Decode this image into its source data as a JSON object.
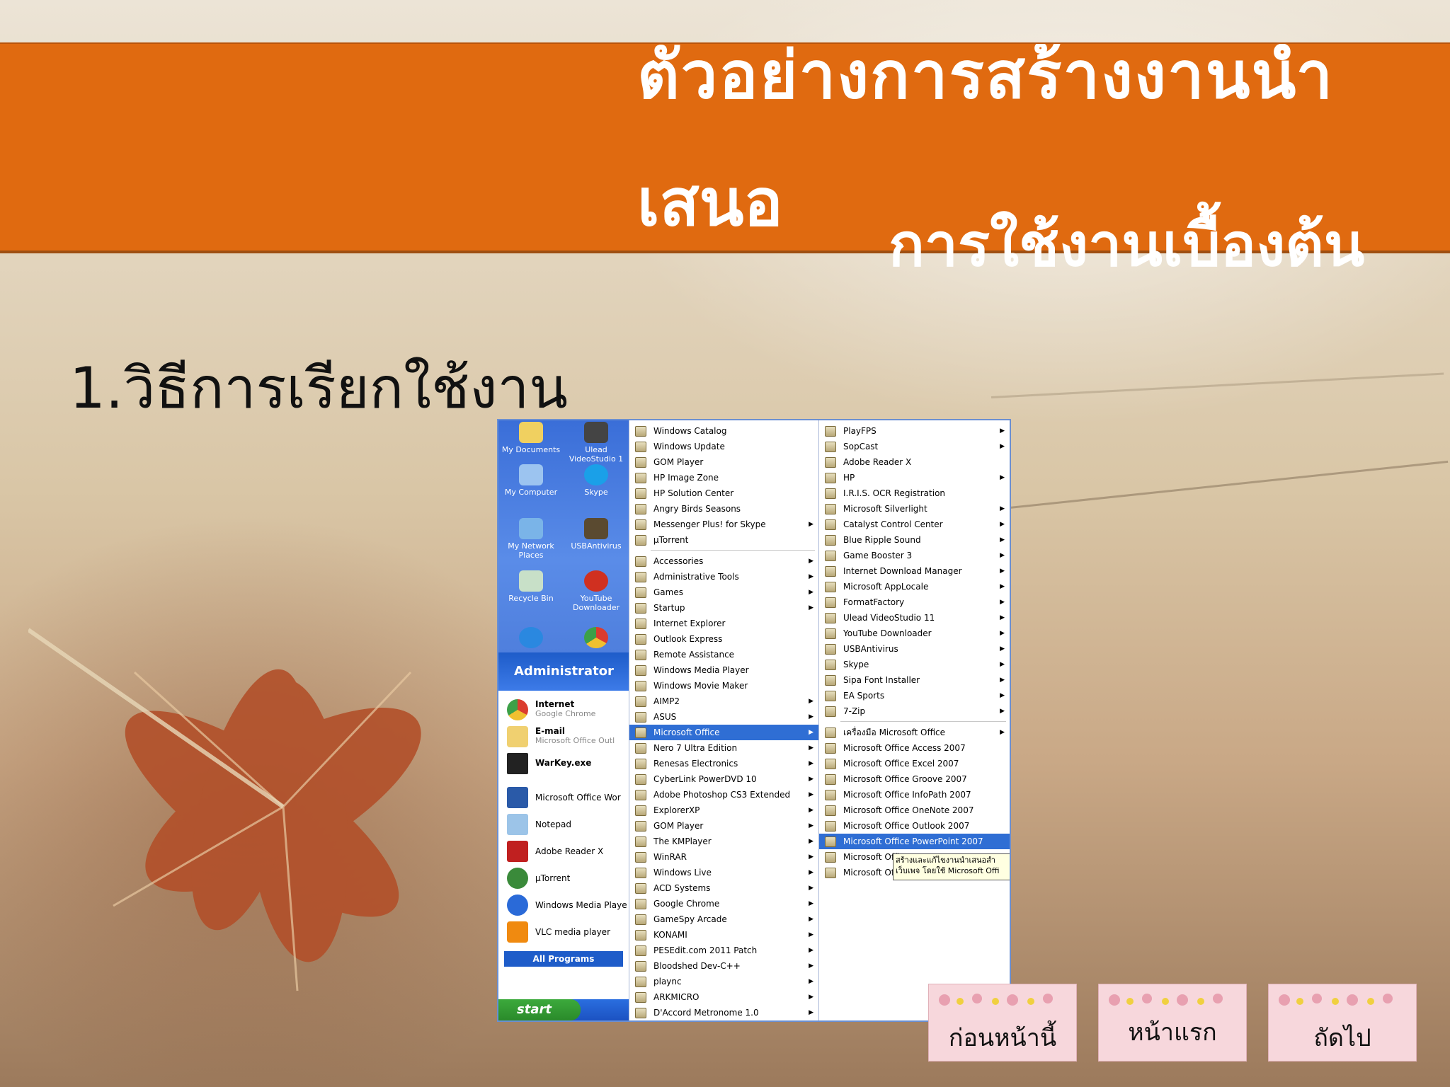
{
  "title": {
    "line1": "ตัวอย่างการสร้างงานนำ",
    "line2": "เสนอ",
    "subtitle": "การใช้งานเบื้องต้น"
  },
  "step_heading": "1.วิธีการเรียกใช้งาน",
  "screenshot": {
    "desktop_icons": [
      "My Documents",
      "Ulead VideoStudio 1",
      "My Computer",
      "Skype",
      "My Network Places",
      "USBAntivirus",
      "Recycle Bin",
      "YouTube Downloader"
    ],
    "user": "Administrator",
    "pinned": [
      {
        "title": "Internet",
        "sub": "Google Chrome"
      },
      {
        "title": "E-mail",
        "sub": "Microsoft Office Outl"
      },
      {
        "title": "WarKey.exe",
        "sub": ""
      }
    ],
    "recent": [
      "Microsoft Office Wor",
      "Notepad",
      "Adobe Reader X",
      "µTorrent",
      "Windows Media Playe",
      "VLC media player"
    ],
    "all_programs": "All Programs",
    "start": "start",
    "programs_top": [
      "Windows Catalog",
      "Windows Update",
      "GOM Player",
      "HP Image Zone",
      "HP Solution Center",
      "Angry Birds Seasons",
      "Messenger Plus! for Skype",
      "µTorrent"
    ],
    "programs": [
      "Accessories",
      "Administrative Tools",
      "Games",
      "Startup",
      "Internet Explorer",
      "Outlook Express",
      "Remote Assistance",
      "Windows Media Player",
      "Windows Movie Maker",
      "AIMP2",
      "ASUS",
      "Microsoft Office",
      "Nero 7 Ultra Edition",
      "Renesas Electronics",
      "CyberLink PowerDVD 10",
      "Adobe Photoshop CS3 Extended",
      "ExplorerXP",
      "GOM Player",
      "The KMPlayer",
      "WinRAR",
      "Windows Live",
      "ACD Systems",
      "Google Chrome",
      "GameSpy Arcade",
      "KONAMI",
      "PESEdit.com 2011 Patch",
      "Bloodshed Dev-C++",
      "plaync",
      "ARKMICRO",
      "D'Accord Metronome 1.0"
    ],
    "programs2": [
      "PlayFPS",
      "SopCast",
      "Adobe Reader X",
      "HP",
      "I.R.I.S. OCR Registration",
      "Microsoft Silverlight",
      "Catalyst Control Center",
      "Blue Ripple Sound",
      "Game Booster 3",
      "Internet Download Manager",
      "Microsoft AppLocale",
      "FormatFactory",
      "Ulead VideoStudio 11",
      "YouTube Downloader",
      "USBAntivirus",
      "Skype",
      "Sipa Font Installer",
      "EA Sports",
      "7-Zip"
    ],
    "office_menu": [
      "เครื่องมือ Microsoft Office",
      "Microsoft Office Access 2007",
      "Microsoft Office Excel 2007",
      "Microsoft Office Groove 2007",
      "Microsoft Office InfoPath 2007",
      "Microsoft Office OneNote 2007",
      "Microsoft Office Outlook 2007",
      "Microsoft Office PowerPoint 2007",
      "Microsoft Office",
      "Microsoft Office"
    ],
    "tooltip_line1": "สร้างและแก้ไขงานนำเสนอสำ",
    "tooltip_line2": "เว็บเพจ โดยใช้ Microsoft Offi"
  },
  "nav": {
    "prev": "ก่อนหน้านี้",
    "home": "หน้าแรก",
    "next": "ถัดไป"
  },
  "colors": {
    "title_band": "#e06a10",
    "selection": "#2f6ed4",
    "nav_button": "#f7d7dc"
  }
}
